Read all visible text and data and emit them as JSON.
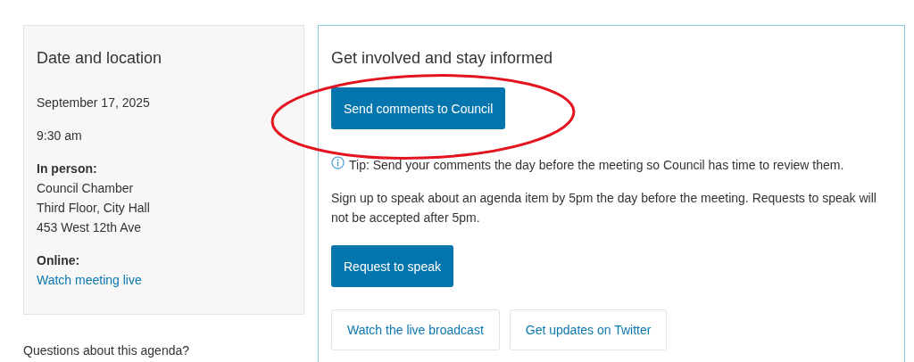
{
  "date_location": {
    "title": "Date and location",
    "date": "September 17, 2025",
    "time": "9:30 am",
    "in_person": {
      "label": "In person:",
      "lines": [
        "Council Chamber",
        "Third Floor, City Hall",
        "453 West 12th Ave"
      ]
    },
    "online": {
      "label": "Online:",
      "link": "Watch meeting live"
    }
  },
  "questions": "Questions about this agenda?",
  "get_involved": {
    "title": "Get involved and stay informed",
    "primary_button": "Send comments to Council",
    "tip": "Tip: Send your comments the day before the meeting so Council has time to review them.",
    "speak_note": "Sign up to speak about an agenda item by 5pm the day before the meeting. Requests to speak will not be accepted after 5pm.",
    "speak_button": "Request to speak",
    "link_buttons": [
      "Watch the live broadcast",
      "Get updates on Twitter"
    ]
  },
  "annotation": {
    "kind": "ellipse",
    "color": "#e3141f"
  }
}
